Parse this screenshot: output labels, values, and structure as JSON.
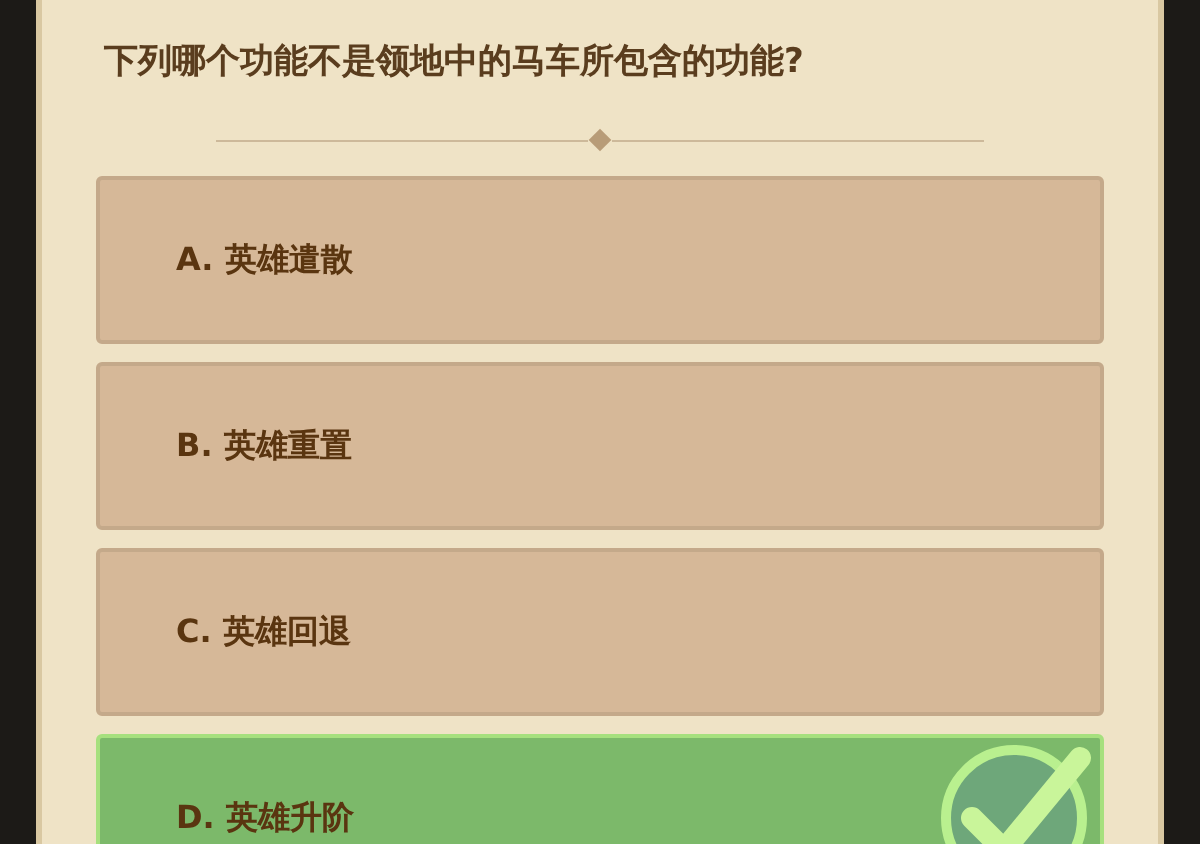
{
  "question": "下列哪个功能不是领地中的马车所包含的功能?",
  "options": [
    {
      "label": "A. 英雄遣散",
      "selected": false
    },
    {
      "label": "B. 英雄重置",
      "selected": false
    },
    {
      "label": "C. 英雄回退",
      "selected": false
    },
    {
      "label": "D. 英雄升阶",
      "selected": true
    }
  ]
}
